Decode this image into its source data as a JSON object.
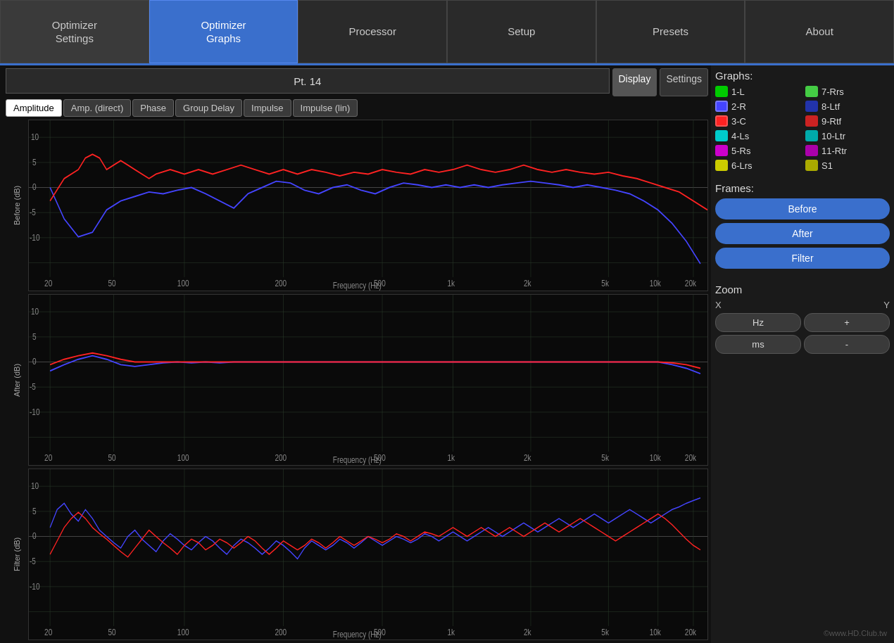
{
  "nav": {
    "tabs": [
      {
        "id": "optimizer-settings",
        "label": "Optimizer\nSettings",
        "active": false
      },
      {
        "id": "optimizer-graphs",
        "label": "Optimizer\nGraphs",
        "active": true
      },
      {
        "id": "processor",
        "label": "Processor",
        "active": false
      },
      {
        "id": "setup",
        "label": "Setup",
        "active": false
      },
      {
        "id": "presets",
        "label": "Presets",
        "active": false
      },
      {
        "id": "about",
        "label": "About",
        "active": false
      }
    ]
  },
  "point_header": "Pt. 14",
  "sidebar_tabs": [
    {
      "id": "display",
      "label": "Display",
      "active": true
    },
    {
      "id": "settings",
      "label": "Settings",
      "active": false
    }
  ],
  "graph_tabs": [
    {
      "id": "amplitude",
      "label": "Amplitude",
      "active": true
    },
    {
      "id": "amp-direct",
      "label": "Amp. (direct)",
      "active": false
    },
    {
      "id": "phase",
      "label": "Phase",
      "active": false
    },
    {
      "id": "group-delay",
      "label": "Group Delay",
      "active": false
    },
    {
      "id": "impulse",
      "label": "Impulse",
      "active": false
    },
    {
      "id": "impulse-lin",
      "label": "Impulse (lin)",
      "active": false
    }
  ],
  "charts": [
    {
      "id": "before",
      "y_label": "Before (dB)"
    },
    {
      "id": "after",
      "y_label": "After (dB)"
    },
    {
      "id": "filter",
      "y_label": "Filter (dB)"
    }
  ],
  "x_axis": {
    "label": "Frequency (Hz)",
    "ticks": [
      "20",
      "50",
      "100",
      "200",
      "500",
      "1k",
      "2k",
      "5k",
      "10k",
      "20k"
    ]
  },
  "y_axis": {
    "ticks": [
      "10",
      "5",
      "0",
      "-5",
      "-10"
    ]
  },
  "graphs_section": {
    "label": "Graphs:",
    "items": [
      {
        "id": "1L",
        "label": "1-L",
        "color": "#00cc00",
        "active": false
      },
      {
        "id": "7Rrs",
        "label": "7-Rrs",
        "color": "#44cc44",
        "active": false
      },
      {
        "id": "2R",
        "label": "2-R",
        "color": "#4444ff",
        "active": true
      },
      {
        "id": "8Ltf",
        "label": "8-Ltf",
        "color": "#2222aa",
        "active": false
      },
      {
        "id": "3C",
        "label": "3-C",
        "color": "#ff2222",
        "active": true
      },
      {
        "id": "9Rtf",
        "label": "9-Rtf",
        "color": "#cc2222",
        "active": false
      },
      {
        "id": "4Ls",
        "label": "4-Ls",
        "color": "#00cccc",
        "active": false
      },
      {
        "id": "10Ltr",
        "label": "10-Ltr",
        "color": "#00aaaa",
        "active": false
      },
      {
        "id": "5Rs",
        "label": "5-Rs",
        "color": "#cc00cc",
        "active": false
      },
      {
        "id": "11Rtr",
        "label": "11-Rtr",
        "color": "#aa00aa",
        "active": false
      },
      {
        "id": "6Lrs",
        "label": "6-Lrs",
        "color": "#cccc00",
        "active": false
      },
      {
        "id": "S1",
        "label": "S1",
        "color": "#aaaa00",
        "active": false
      }
    ]
  },
  "frames_section": {
    "label": "Frames:",
    "buttons": [
      {
        "id": "before",
        "label": "Before"
      },
      {
        "id": "after",
        "label": "After"
      },
      {
        "id": "filter",
        "label": "Filter"
      }
    ]
  },
  "zoom_section": {
    "label": "Zoom",
    "x_label": "X",
    "y_label": "Y",
    "buttons": [
      {
        "id": "hz",
        "label": "Hz"
      },
      {
        "id": "plus",
        "label": "+"
      },
      {
        "id": "ms",
        "label": "ms"
      },
      {
        "id": "minus",
        "label": "-"
      }
    ]
  },
  "copyright": "©www.HD.Club.tw"
}
